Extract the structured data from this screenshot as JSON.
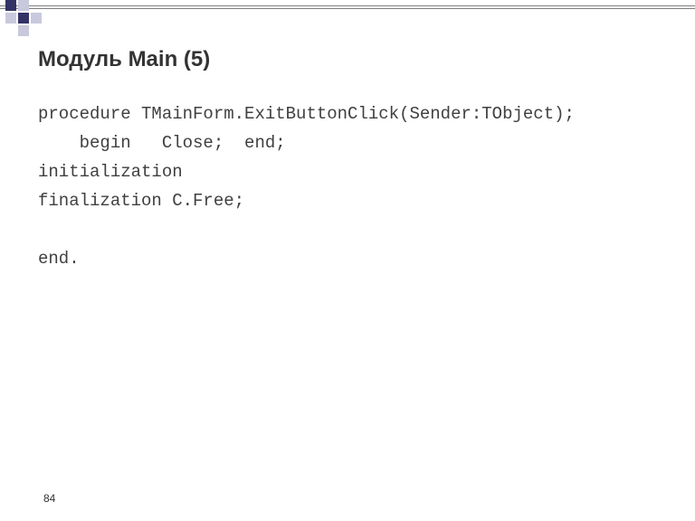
{
  "title": "Модуль Main (5)",
  "code": {
    "l1": "procedure TMainForm.ExitButtonClick(Sender:TObject);",
    "l2": "    begin   Close;  end;",
    "l3": "initialization",
    "l4": "finalization C.Free;",
    "l5": "",
    "l6": "end."
  },
  "page_number": "84"
}
